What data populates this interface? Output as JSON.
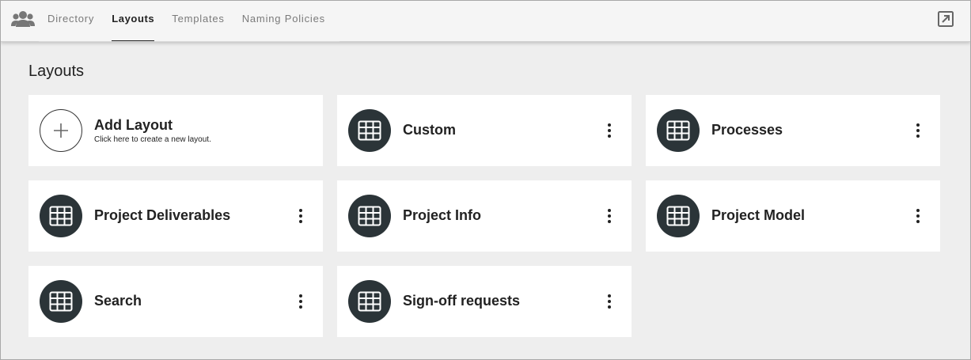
{
  "header": {
    "app_icon": "people-group-icon",
    "tabs": [
      {
        "label": "Directory",
        "active": false
      },
      {
        "label": "Layouts",
        "active": true
      },
      {
        "label": "Templates",
        "active": false
      },
      {
        "label": "Naming Policies",
        "active": false
      }
    ],
    "external_icon": "open-external-icon"
  },
  "main": {
    "title": "Layouts",
    "add_card": {
      "title": "Add Layout",
      "subtitle": "Click here to create a new layout.",
      "icon": "plus-icon"
    },
    "layouts": [
      {
        "title": "Custom",
        "icon": "grid-table-icon"
      },
      {
        "title": "Processes",
        "icon": "grid-table-icon"
      },
      {
        "title": "Project Deliverables",
        "icon": "grid-table-icon"
      },
      {
        "title": "Project Info",
        "icon": "grid-table-icon"
      },
      {
        "title": "Project Model",
        "icon": "grid-table-icon"
      },
      {
        "title": "Search",
        "icon": "grid-table-icon"
      },
      {
        "title": "Sign-off requests",
        "icon": "grid-table-icon"
      }
    ]
  },
  "colors": {
    "background": "#eeeeee",
    "card": "#ffffff",
    "icon_circle": "#2b3438",
    "text": "#222222",
    "tab_inactive": "#7a7a7a"
  }
}
